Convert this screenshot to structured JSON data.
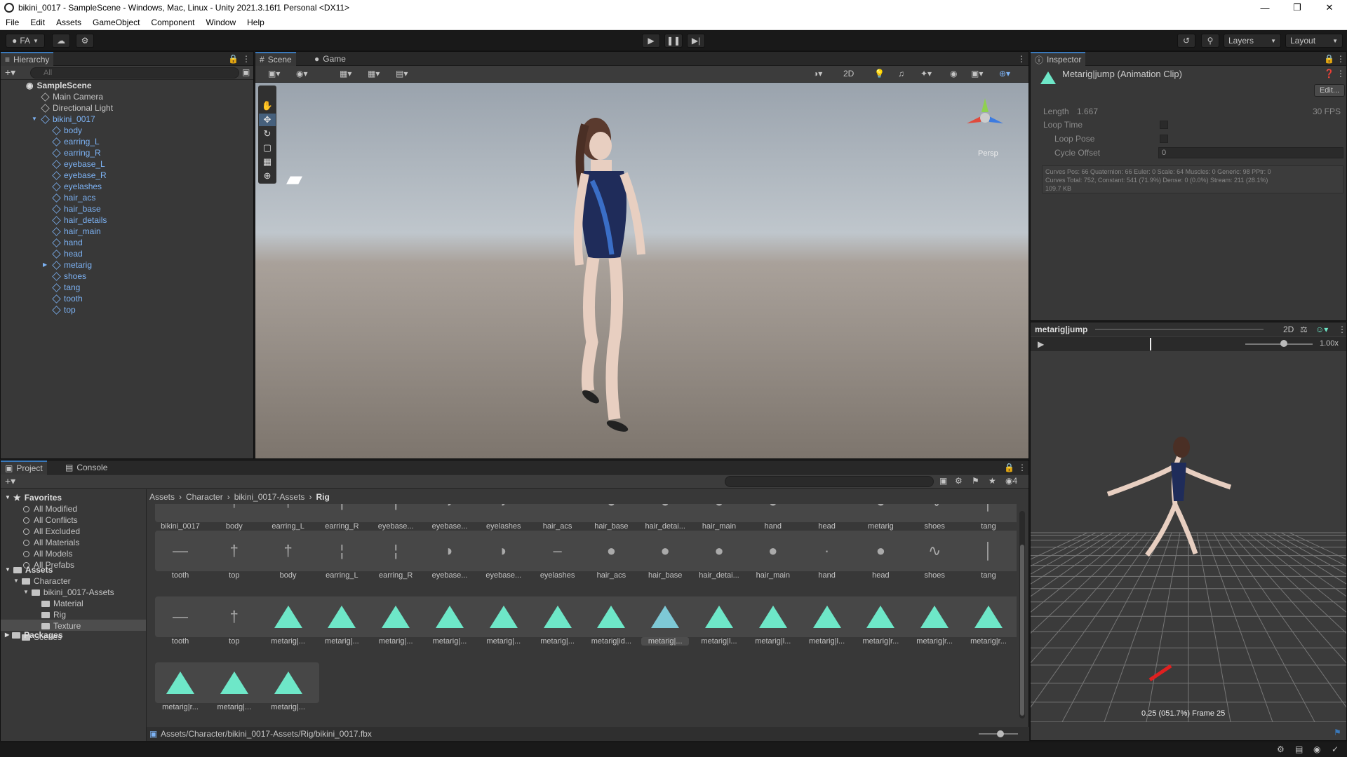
{
  "window": {
    "title": "bikini_0017 - SampleScene - Windows, Mac, Linux - Unity 2021.3.16f1 Personal <DX11>"
  },
  "menu": [
    "File",
    "Edit",
    "Assets",
    "GameObject",
    "Component",
    "Window",
    "Help"
  ],
  "toolbar": {
    "account": "FA",
    "layers": "Layers",
    "layout": "Layout"
  },
  "hierarchy": {
    "tab": "Hierarchy",
    "search_placeholder": "All",
    "scene": "SampleScene",
    "items": [
      {
        "label": "Main Camera",
        "depth": 1,
        "blue": false
      },
      {
        "label": "Directional Light",
        "depth": 1,
        "blue": false
      },
      {
        "label": "bikini_0017",
        "depth": 1,
        "blue": true
      },
      {
        "label": "body",
        "depth": 2,
        "blue": true
      },
      {
        "label": "earring_L",
        "depth": 2,
        "blue": true
      },
      {
        "label": "earring_R",
        "depth": 2,
        "blue": true
      },
      {
        "label": "eyebase_L",
        "depth": 2,
        "blue": true
      },
      {
        "label": "eyebase_R",
        "depth": 2,
        "blue": true
      },
      {
        "label": "eyelashes",
        "depth": 2,
        "blue": true
      },
      {
        "label": "hair_acs",
        "depth": 2,
        "blue": true
      },
      {
        "label": "hair_base",
        "depth": 2,
        "blue": true
      },
      {
        "label": "hair_details",
        "depth": 2,
        "blue": true
      },
      {
        "label": "hair_main",
        "depth": 2,
        "blue": true
      },
      {
        "label": "hand",
        "depth": 2,
        "blue": true
      },
      {
        "label": "head",
        "depth": 2,
        "blue": true
      },
      {
        "label": "metarig",
        "depth": 2,
        "blue": true
      },
      {
        "label": "shoes",
        "depth": 2,
        "blue": true
      },
      {
        "label": "tang",
        "depth": 2,
        "blue": true
      },
      {
        "label": "tooth",
        "depth": 2,
        "blue": true
      },
      {
        "label": "top",
        "depth": 2,
        "blue": true
      }
    ]
  },
  "scene": {
    "tab_scene": "Scene",
    "tab_game": "Game",
    "mode_2d": "2D",
    "persp": "Persp"
  },
  "inspector": {
    "tab": "Inspector",
    "title": "Metarig|jump (Animation Clip)",
    "edit": "Edit...",
    "length_label": "Length",
    "length_value": "1.667",
    "fps": "30 FPS",
    "loop_time": "Loop Time",
    "loop_pose": "Loop Pose",
    "cycle_offset": "Cycle Offset",
    "cycle_offset_value": "0",
    "stats_line1": "Curves Pos: 66 Quaternion: 66 Euler: 0 Scale: 64 Muscles: 0 Generic: 98 PPtr: 0",
    "stats_line2": "Curves Total: 752, Constant: 541 (71.9%) Dense: 0 (0.0%) Stream: 211 (28.1%)",
    "stats_line3": "109.7 KB"
  },
  "preview": {
    "clip": "metarig|jump",
    "mode_2d": "2D",
    "speed": "1.00x",
    "frame_info": "0.25 (051.7%) Frame 25"
  },
  "project": {
    "tab_project": "Project",
    "tab_console": "Console",
    "favorites_label": "Favorites",
    "favorites": [
      "All Modified",
      "All Conflicts",
      "All Excluded",
      "All Materials",
      "All Models",
      "All Prefabs"
    ],
    "assets_label": "Assets",
    "tree": [
      {
        "label": "Character",
        "depth": 1
      },
      {
        "label": "bikini_0017-Assets",
        "depth": 2
      },
      {
        "label": "Material",
        "depth": 3
      },
      {
        "label": "Rig",
        "depth": 3
      },
      {
        "label": "Texture",
        "depth": 3
      },
      {
        "label": "Scenes",
        "depth": 1
      }
    ],
    "packages_label": "Packages",
    "breadcrumb": [
      "Assets",
      "Character",
      "bikini_0017-Assets",
      "Rig"
    ],
    "hidden_count": "4",
    "row1": [
      "bikini_0017",
      "body",
      "earring_L",
      "earring_R",
      "eyebase...",
      "eyebase...",
      "eyelashes",
      "hair_acs",
      "hair_base",
      "hair_detai...",
      "hair_main",
      "hand",
      "head",
      "metarig",
      "shoes",
      "tang"
    ],
    "row2": [
      "tooth",
      "top",
      "body",
      "earring_L",
      "earring_R",
      "eyebase...",
      "eyebase...",
      "eyelashes",
      "hair_acs",
      "hair_base",
      "hair_detai...",
      "hair_main",
      "hand",
      "head",
      "shoes",
      "tang"
    ],
    "row3": [
      "tooth",
      "top",
      "metarig|...",
      "metarig|...",
      "metarig|...",
      "metarig|...",
      "metarig|...",
      "metarig|...",
      "metarig|id...",
      "metarig|...",
      "metarig|l...",
      "metarig|l...",
      "metarig|l...",
      "metarig|r...",
      "metarig|r...",
      "metarig|r..."
    ],
    "row4": [
      "metarig|r...",
      "metarig|...",
      "metarig|..."
    ],
    "path": "Assets/Character/bikini_0017-Assets/Rig/bikini_0017.fbx"
  },
  "colors": {
    "accent": "#3a79bb",
    "anim_clip": "#6ee7c8",
    "prefab_blue": "#7db3f5"
  }
}
